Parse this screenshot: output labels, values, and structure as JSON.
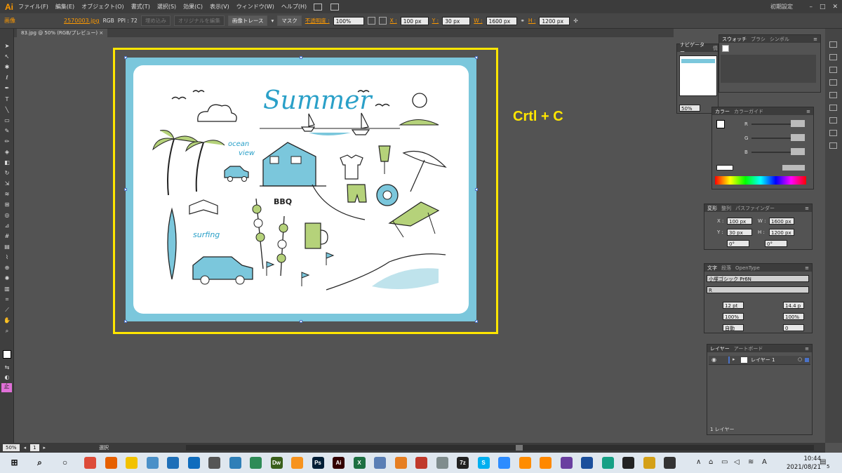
{
  "app": {
    "logo": "Ai",
    "menu": [
      "ファイル(F)",
      "編集(E)",
      "オブジェクト(O)",
      "書式(T)",
      "選択(S)",
      "効果(C)",
      "表示(V)",
      "ウィンドウ(W)",
      "ヘルプ(H)"
    ],
    "workspace": "初期設定",
    "window_controls": [
      "–",
      "□",
      "✕"
    ]
  },
  "control_bar": {
    "selection": "画像",
    "filename": "2570003.jpg",
    "color_mode": "RGB",
    "ppi": "PPI : 72",
    "embed_btn": "埋め込み",
    "edit_original_btn": "オリジナルを編集",
    "image_trace_btn": "画像トレース",
    "mask_btn": "マスク",
    "opacity_label": "不透明度 :",
    "opacity": "100%",
    "x_label": "X :",
    "x": "100 px",
    "y_label": "Y :",
    "y": "30 px",
    "w_label": "W :",
    "w": "1600 px",
    "h_label": "H :",
    "h": "1200 px"
  },
  "doc_tab": "83.jpg @ 50% (RGB/プレビュー)",
  "overlay": "Crtl + C",
  "art": {
    "title_word": "Summer",
    "ocean_line1": "ocean",
    "ocean_line2": "view",
    "bbq": "BBQ",
    "surfing": "surfing"
  },
  "panels": {
    "navigator": {
      "tab1": "ナビゲーター",
      "tab2": "情",
      "zoom": "50%"
    },
    "swatches": {
      "tabs": [
        "スウォッチ",
        "ブラシ",
        "シンボル"
      ]
    },
    "color": {
      "tabs": [
        "カラー",
        "カラーガイド"
      ],
      "channels": [
        "R",
        "G",
        "B"
      ]
    },
    "transform": {
      "tabs": [
        "変形",
        "整列",
        "パスファインダー"
      ],
      "x_label": "X :",
      "x": "100 px",
      "y_label": "Y :",
      "y": "30 px",
      "w_label": "W :",
      "w": "1600 px",
      "h_label": "H :",
      "h": "1200 px",
      "angle": "0°",
      "shear": "0°"
    },
    "character": {
      "tabs": [
        "文字",
        "段落",
        "OpenType"
      ],
      "font": "小塚ゴシック Pr6N",
      "style": "R",
      "size": "12 pt",
      "leading": "14.4 p",
      "vscale": "100%",
      "hscale": "100%",
      "kerning": "自動",
      "tracking": "0"
    },
    "layers": {
      "tabs": [
        "レイヤー",
        "アートボード"
      ],
      "layer_name": "レイヤー 1",
      "footer": "1 レイヤー"
    }
  },
  "status": {
    "zoom": "50%",
    "page": "1",
    "tool": "選択"
  },
  "taskbar": {
    "time": "10:44",
    "date": "2021/08/21",
    "ime": "A",
    "notification_count": "5",
    "apps": [
      {
        "name": "chrome",
        "color": "#dd4b39"
      },
      {
        "name": "firefox",
        "color": "#e66000"
      },
      {
        "name": "explorer",
        "color": "#f2c200"
      },
      {
        "name": "app4",
        "color": "#4a90c8"
      },
      {
        "name": "photos",
        "color": "#1e6fb8"
      },
      {
        "name": "outlook",
        "color": "#0f6cbd"
      },
      {
        "name": "settings",
        "color": "#555555"
      },
      {
        "name": "app8",
        "color": "#2f7fb8"
      },
      {
        "name": "app9",
        "color": "#2e8b57"
      },
      {
        "name": "dreamweaver",
        "color": "#3a5f1b",
        "label": "Dw"
      },
      {
        "name": "app11",
        "color": "#f7931e"
      },
      {
        "name": "photoshop",
        "color": "#001e36",
        "label": "Ps"
      },
      {
        "name": "illustrator",
        "color": "#330000",
        "label": "Ai"
      },
      {
        "name": "excel",
        "color": "#1d6f42",
        "label": "X"
      },
      {
        "name": "app15",
        "color": "#5a7fb5"
      },
      {
        "name": "butterfly",
        "color": "#e67e22"
      },
      {
        "name": "app17",
        "color": "#c0392b"
      },
      {
        "name": "app18",
        "color": "#7f8c8d"
      },
      {
        "name": "7zip",
        "color": "#222222",
        "label": "7z"
      },
      {
        "name": "skype",
        "color": "#00aff0",
        "label": "S"
      },
      {
        "name": "zoom",
        "color": "#2d8cff"
      },
      {
        "name": "app22",
        "color": "#ff8c00"
      },
      {
        "name": "vlc",
        "color": "#ff8800"
      },
      {
        "name": "app24",
        "color": "#6a3fa0"
      },
      {
        "name": "music",
        "color": "#1b4f9c"
      },
      {
        "name": "app26",
        "color": "#16a085"
      },
      {
        "name": "record",
        "color": "#222222"
      },
      {
        "name": "app28",
        "color": "#d4a017"
      },
      {
        "name": "app29",
        "color": "#333333"
      }
    ]
  },
  "colors": {
    "highlight": "#ffe600",
    "artboard_frame": "#7bc7dc",
    "accent_orange": "#ff9a00",
    "art_green": "#b5d27a",
    "art_blue": "#2aa0c8"
  }
}
